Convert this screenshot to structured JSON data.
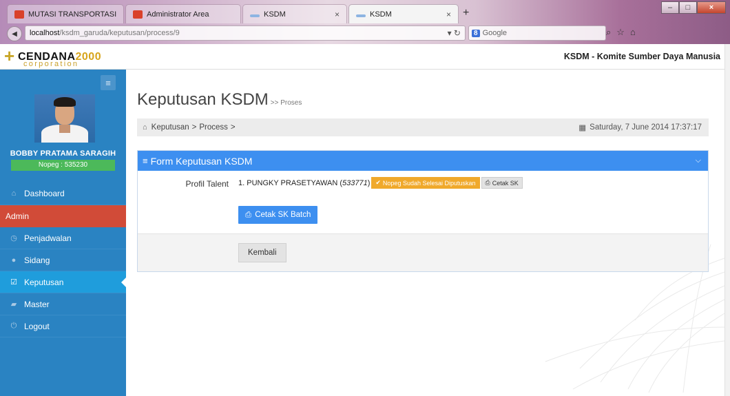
{
  "browser": {
    "tabs": [
      {
        "label": "MUTASI TRANSPORTASI",
        "favicon": "red-favicon",
        "active": false
      },
      {
        "label": "Administrator Area",
        "favicon": "red-favicon",
        "active": false
      },
      {
        "label": "KSDM",
        "favicon": "blue-favicon",
        "active": false,
        "close": "×"
      },
      {
        "label": "KSDM",
        "favicon": "blue-favicon",
        "active": true,
        "close": "×"
      }
    ],
    "new_tab": "+",
    "url_host": "localhost",
    "url_path": "/ksdm_garuda/keputusan/process/9",
    "search_engine_badge": "8",
    "search_placeholder": "Google"
  },
  "app": {
    "logo_name_a": "CENDANA",
    "logo_name_b": "2000",
    "logo_sub": "corporation",
    "title": "KSDM - Komite Sumber Daya Manusia"
  },
  "sidebar": {
    "user_name": "BOBBY PRATAMA SARAGIH",
    "nopeg": "Nopeg : 535230",
    "items": [
      {
        "label": "Dashboard",
        "icon": "home-icon"
      },
      {
        "label": "Admin",
        "icon": ""
      },
      {
        "label": "Penjadwalan",
        "icon": "clock-icon"
      },
      {
        "label": "Sidang",
        "icon": "arrow-circle-icon"
      },
      {
        "label": "Keputusan",
        "icon": "check-square-icon"
      },
      {
        "label": "Master",
        "icon": "briefcase-icon"
      },
      {
        "label": "Logout",
        "icon": "power-icon"
      }
    ]
  },
  "main": {
    "page_title": "Keputusan KSDM",
    "page_subtitle": ">> Proses",
    "breadcrumb": {
      "item1": "Keputusan",
      "item2": "Process",
      "sep": ">"
    },
    "date": "Saturday, 7 June 2014 17:37:17",
    "panel": {
      "title": "Form Keputusan KSDM",
      "label_profil": "Profil Talent",
      "talent_prefix": "1. PUNGKY PRASETYAWAN (",
      "talent_nopeg": "533771",
      "talent_suffix": ")",
      "status_badge": "Nopeg Sudah Selesai Diputuskan",
      "cetak_sk": "Cetak SK",
      "cetak_batch": "Cetak SK Batch",
      "kembali": "Kembali"
    }
  },
  "colors": {
    "sidebar_bg": "#2a83c2",
    "admin_bg": "#d14b38",
    "active_bg": "#1f9ddc",
    "primary": "#3d8ff0",
    "badge_warning": "#f0a92b",
    "nopeg_green": "#4cb95a"
  }
}
